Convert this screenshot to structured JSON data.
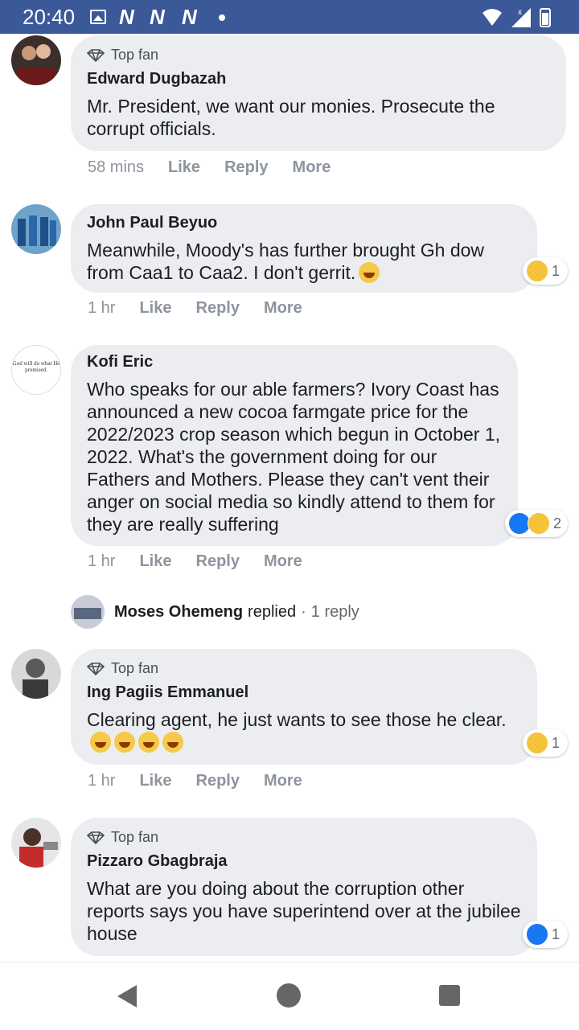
{
  "status_bar": {
    "time": "20:40",
    "notif_letter": "N"
  },
  "topfan_label": "Top fan",
  "actions": {
    "like": "Like",
    "reply": "Reply",
    "more": "More"
  },
  "comments": [
    {
      "author": "Edward Dugbazah",
      "text": "Mr. President, we want our monies. Prosecute the corrupt officials.",
      "time": "58 mins"
    },
    {
      "author": "John Paul Beyuo",
      "text": "Meanwhile, Moody's has further brought Gh dow from Caa1 to Caa2. I don't gerrit.",
      "time": "1 hr",
      "reaction_count": "1"
    },
    {
      "author": "Kofi Eric",
      "text": "Who speaks for our able farmers? Ivory Coast has announced a new cocoa farmgate price for the 2022/2023 crop season which begun in October 1, 2022. What's the government doing for our Fathers and Mothers. Please they can't vent their anger on social media so kindly attend to them for they are really suffering",
      "time": "1 hr",
      "reaction_count": "2"
    },
    {
      "author": "Ing Pagiis Emmanuel",
      "text": "Clearing agent, he just wants to see those he clear.",
      "time": "1 hr",
      "reaction_count": "1"
    },
    {
      "author": "Pizzaro Gbagbraja",
      "text": "What are you doing about the corruption other reports says you have superintend over at the jubilee house",
      "reaction_count": "1"
    }
  ],
  "reply_summary": {
    "name": "Moses Ohemeng",
    "verb": "replied",
    "sep": "·",
    "count": "1 reply"
  },
  "avatar_text": {
    "kofi": "God will do what He promised."
  }
}
